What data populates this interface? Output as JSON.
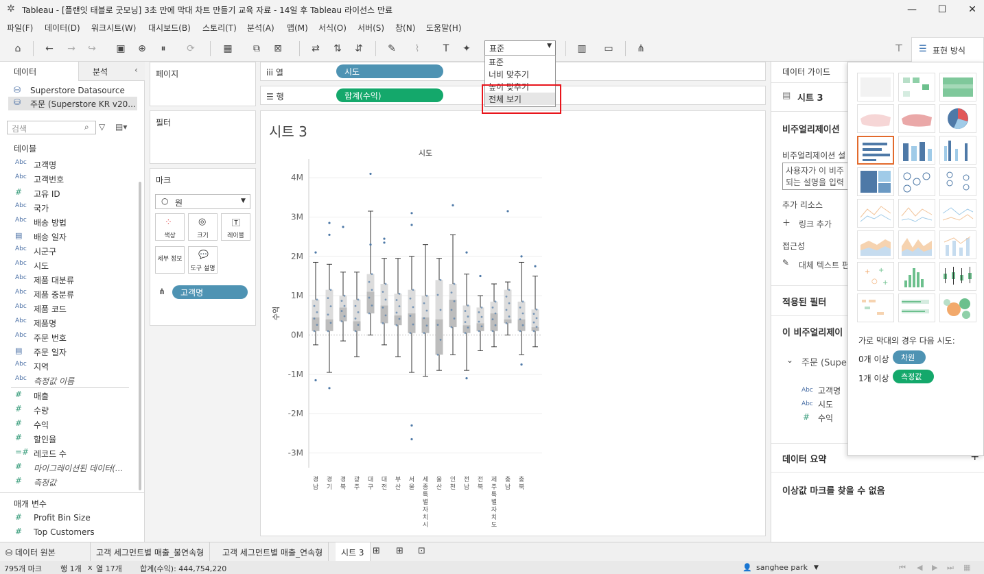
{
  "window": {
    "title": "Tableau - [플랜잇 태블로 굿모닝] 3초 만에 막대 차트 만들기 교육 자료 - 14일 후 Tableau 라이선스 만료"
  },
  "menu": [
    "파일(F)",
    "데이터(D)",
    "워크시트(W)",
    "대시보드(B)",
    "스토리(T)",
    "분석(A)",
    "맵(M)",
    "서식(O)",
    "서버(S)",
    "창(N)",
    "도움말(H)"
  ],
  "toolbar": {
    "fit_value": "표준",
    "show_me_label": "표현 방식"
  },
  "fit_menu": {
    "options": [
      "표준",
      "너비 맞추기",
      "높이 맞추기",
      "전체 보기"
    ],
    "highlighted": "전체 보기"
  },
  "left": {
    "tab_data": "데이터",
    "tab_analysis": "분석",
    "sources": [
      "Superstore Datasource",
      "주문 (Superstore KR v20..."
    ],
    "search_placeholder": "검색",
    "tables_header": "테이블",
    "dimensions": [
      {
        "icon": "Abc",
        "name": "고객명"
      },
      {
        "icon": "Abc",
        "name": "고객번호"
      },
      {
        "icon": "#",
        "name": "고유 ID"
      },
      {
        "icon": "Abc",
        "name": "국가"
      },
      {
        "icon": "Abc",
        "name": "배송 방법"
      },
      {
        "icon": "cal",
        "name": "배송 일자"
      },
      {
        "icon": "Abc",
        "name": "시군구"
      },
      {
        "icon": "Abc",
        "name": "시도"
      },
      {
        "icon": "Abc",
        "name": "제품 대분류"
      },
      {
        "icon": "Abc",
        "name": "제품 중분류"
      },
      {
        "icon": "Abc",
        "name": "제품 코드"
      },
      {
        "icon": "Abc",
        "name": "제품명"
      },
      {
        "icon": "Abc",
        "name": "주문 번호"
      },
      {
        "icon": "cal",
        "name": "주문 일자"
      },
      {
        "icon": "Abc",
        "name": "지역"
      },
      {
        "icon": "Abc",
        "name": "측정값 이름",
        "italic": true
      }
    ],
    "measures": [
      {
        "icon": "#",
        "name": "매출"
      },
      {
        "icon": "#",
        "name": "수량"
      },
      {
        "icon": "#",
        "name": "수익"
      },
      {
        "icon": "#",
        "name": "할인율"
      },
      {
        "icon": "=#",
        "name": "레코드 수"
      },
      {
        "icon": "#",
        "name": "마이그레이션된 데이터(...",
        "italic": true
      },
      {
        "icon": "#",
        "name": "측정값",
        "italic": true
      }
    ],
    "params_header": "매개 변수",
    "params": [
      "Profit Bin Size",
      "Top Customers"
    ]
  },
  "shelves": {
    "pages": "페이지",
    "filters": "필터",
    "marks": "마크",
    "mark_type": "원",
    "mark_buttons": [
      "색상",
      "크기",
      "레이블",
      "세부 정보",
      "도구 설명"
    ],
    "detail_pill": "고객명",
    "columns_label": "열",
    "rows_label": "행",
    "columns_pill": "시도",
    "rows_pill": "합계(수익)"
  },
  "view": {
    "sheet_title": "시트 3"
  },
  "chart_data": {
    "type": "scatter",
    "title": "",
    "column_header": "시도",
    "ylabel": "수익",
    "ylim": [
      -3.2,
      4.3
    ],
    "yticks": [
      "4M",
      "3M",
      "2M",
      "1M",
      "0M",
      "-1M",
      "-2M",
      "-3M"
    ],
    "ytick_values": [
      4,
      3,
      2,
      1,
      0,
      -1,
      -2,
      -3
    ],
    "categories": [
      "경남",
      "경기",
      "경북",
      "광주",
      "대구",
      "대전",
      "부산",
      "서울",
      "세종특별자치시",
      "울산",
      "인천",
      "전남",
      "전북",
      "제주특별자치도",
      "충남",
      "충북"
    ],
    "category_labels": [
      "경남",
      "경기",
      "경북",
      "광주",
      "대구",
      "대전",
      "부산",
      "서울",
      "세종특별자치시",
      "울산",
      "인천",
      "전남",
      "전북",
      "제주특별자치도",
      "충남",
      "충북"
    ],
    "boxplots": [
      {
        "min": -0.25,
        "q1": 0.1,
        "median": 0.45,
        "q3": 0.9,
        "max": 1.85
      },
      {
        "min": -0.95,
        "q1": 0.1,
        "median": 0.4,
        "q3": 1.15,
        "max": 1.8
      },
      {
        "min": -0.15,
        "q1": 0.35,
        "median": 0.7,
        "q3": 1.0,
        "max": 1.6
      },
      {
        "min": -0.55,
        "q1": 0.1,
        "median": 0.35,
        "q3": 0.9,
        "max": 1.6
      },
      {
        "min": 0.0,
        "q1": 0.55,
        "median": 1.1,
        "q3": 1.55,
        "max": 3.15
      },
      {
        "min": -0.25,
        "q1": 0.3,
        "median": 0.75,
        "q3": 1.3,
        "max": 1.95
      },
      {
        "min": -0.55,
        "q1": 0.25,
        "median": 0.5,
        "q3": 1.05,
        "max": 1.95
      },
      {
        "min": -0.95,
        "q1": 0.05,
        "median": 0.55,
        "q3": 1.15,
        "max": 2.0
      },
      {
        "min": -1.05,
        "q1": 0.05,
        "median": 0.45,
        "q3": 1.0,
        "max": 2.3
      },
      {
        "min": -0.9,
        "q1": -0.5,
        "median": 0.4,
        "q3": 1.4,
        "max": 1.95
      },
      {
        "min": -0.5,
        "q1": 0.2,
        "median": 0.9,
        "q3": 1.3,
        "max": 2.55
      },
      {
        "min": -0.9,
        "q1": 0.05,
        "median": 0.25,
        "q3": 0.75,
        "max": 1.55
      },
      {
        "min": -0.4,
        "q1": 0.1,
        "median": 0.3,
        "q3": 0.7,
        "max": 1.0
      },
      {
        "min": -0.3,
        "q1": 0.1,
        "median": 0.55,
        "q3": 0.85,
        "max": 1.3
      },
      {
        "min": 0.0,
        "q1": 0.3,
        "median": 0.4,
        "q3": 1.15,
        "max": 1.35
      },
      {
        "min": -0.5,
        "q1": 0.1,
        "median": 0.4,
        "q3": 0.85,
        "max": 1.85
      },
      {
        "min": -0.3,
        "q1": 0.1,
        "median": 0.2,
        "q3": 0.65,
        "max": 1.5
      }
    ],
    "outliers": [
      {
        "i": 0,
        "y": 2.1
      },
      {
        "i": 0,
        "y": -1.15
      },
      {
        "i": 1,
        "y": 2.85
      },
      {
        "i": 1,
        "y": 2.55
      },
      {
        "i": 1,
        "y": -1.35
      },
      {
        "i": 2,
        "y": 2.75
      },
      {
        "i": 4,
        "y": 4.1
      },
      {
        "i": 4,
        "y": 2.3
      },
      {
        "i": 5,
        "y": 2.45
      },
      {
        "i": 5,
        "y": 2.35
      },
      {
        "i": 7,
        "y": 3.1
      },
      {
        "i": 7,
        "y": 2.8
      },
      {
        "i": 7,
        "y": -2.3
      },
      {
        "i": 7,
        "y": -2.65
      },
      {
        "i": 10,
        "y": 3.3
      },
      {
        "i": 11,
        "y": 2.1
      },
      {
        "i": 11,
        "y": -1.1
      },
      {
        "i": 12,
        "y": 1.5
      },
      {
        "i": 14,
        "y": 3.15
      },
      {
        "i": 15,
        "y": 2.0
      },
      {
        "i": 15,
        "y": -0.75
      },
      {
        "i": 16,
        "y": 1.75
      }
    ]
  },
  "data_guide": {
    "header": "데이터 가이드",
    "sheet": "시트 3",
    "viz_section": "비주얼리제이션",
    "viz_desc_label": "비주얼리제이션 설",
    "viz_desc_placeholder": "사용자가 이 비주\n되는 설명을 입력",
    "add_resource": "추가 리소스",
    "link_add": "링크 추가",
    "accessibility": "접근성",
    "alt_text": "대체 텍스트 편",
    "filters_applied": "적용된 필터",
    "this_viz": "이 비주얼리제이",
    "source_node": "주문 (Supe",
    "fields": [
      {
        "icon": "Abc",
        "name": "고객명"
      },
      {
        "icon": "Abc",
        "name": "시도"
      },
      {
        "icon": "#",
        "name": "수익"
      }
    ],
    "data_summary": "데이터 요약",
    "outliers_none": "이상값 마크를 찾을 수 없음"
  },
  "show_me": {
    "hint": "가로 막대의 경우 다음 시도:",
    "req1_prefix": "0개 이상",
    "req1_pill": "차원",
    "req2_prefix": "1개 이상",
    "req2_pill": "측정값",
    "selected_index": 6
  },
  "bottom_tabs": [
    "데이터 원본",
    "고객 세그먼트별 매출_불연속형",
    "고객 세그먼트별 매출_연속형",
    "시트 3"
  ],
  "status": {
    "marks": "795개 마크",
    "rows": "행 1개",
    "x": "x",
    "cols": "열 17개",
    "sum": "합계(수익): 444,754,220",
    "user": "sanghee park"
  }
}
